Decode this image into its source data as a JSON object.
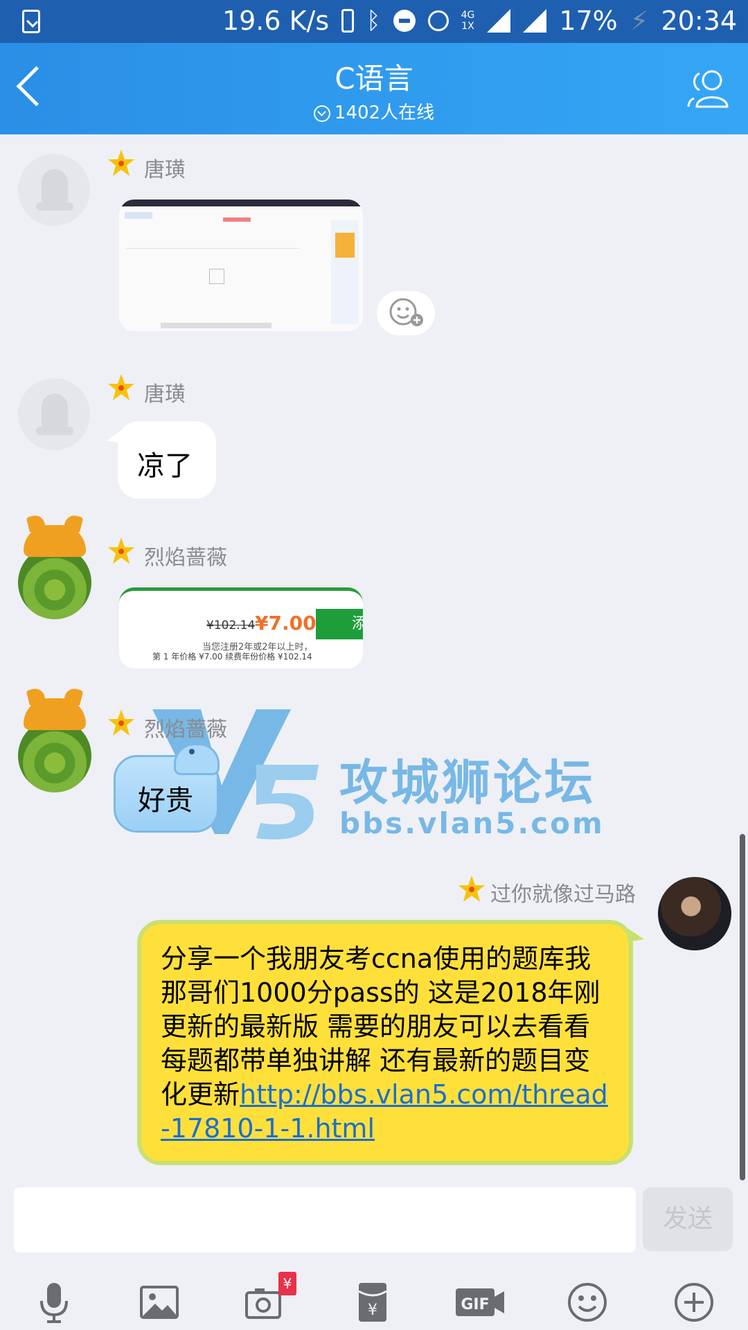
{
  "status_bar": {
    "network_speed": "19.6 K/s",
    "network_type_top": "4G",
    "network_type_bottom": "1X",
    "battery": "17%",
    "time": "20:34"
  },
  "header": {
    "title": "C语言",
    "online_count": "1402人在线"
  },
  "messages": [
    {
      "sender": "唐璜",
      "type": "image"
    },
    {
      "sender": "唐璜",
      "type": "text",
      "text": "凉了"
    },
    {
      "sender": "烈焰蔷薇",
      "type": "image",
      "image_text": {
        "old_price": "¥102.14",
        "new_price": "¥7.00",
        "line1": "当您注册2年或2年以上时，",
        "line2": "第 1 年价格 ¥7.00 续费年份价格 ¥102.14",
        "button": "添"
      }
    },
    {
      "sender": "烈焰蔷薇",
      "type": "text",
      "text": "好贵"
    },
    {
      "sender": "过你就像过马路",
      "type": "text",
      "text": "分享一个我朋友考ccna使用的题库我那哥们1000分pass的 这是2018年刚更新的最新版 需要的朋友可以去看看 每题都带单独讲解 还有最新的题目变化更新",
      "link": "http://bbs.vlan5.com/thread-17810-1-1.html"
    }
  ],
  "watermark": {
    "title": "攻城狮论坛",
    "url": "bbs.vlan5.com",
    "logo": "V5"
  },
  "input": {
    "placeholder": "",
    "send_label": "发送"
  },
  "toolbar": {
    "icons": [
      "mic-icon",
      "image-icon",
      "camera-redpacket-icon",
      "red-envelope-icon",
      "gif-icon",
      "emoji-icon",
      "plus-icon"
    ],
    "camera_badge": "¥"
  }
}
